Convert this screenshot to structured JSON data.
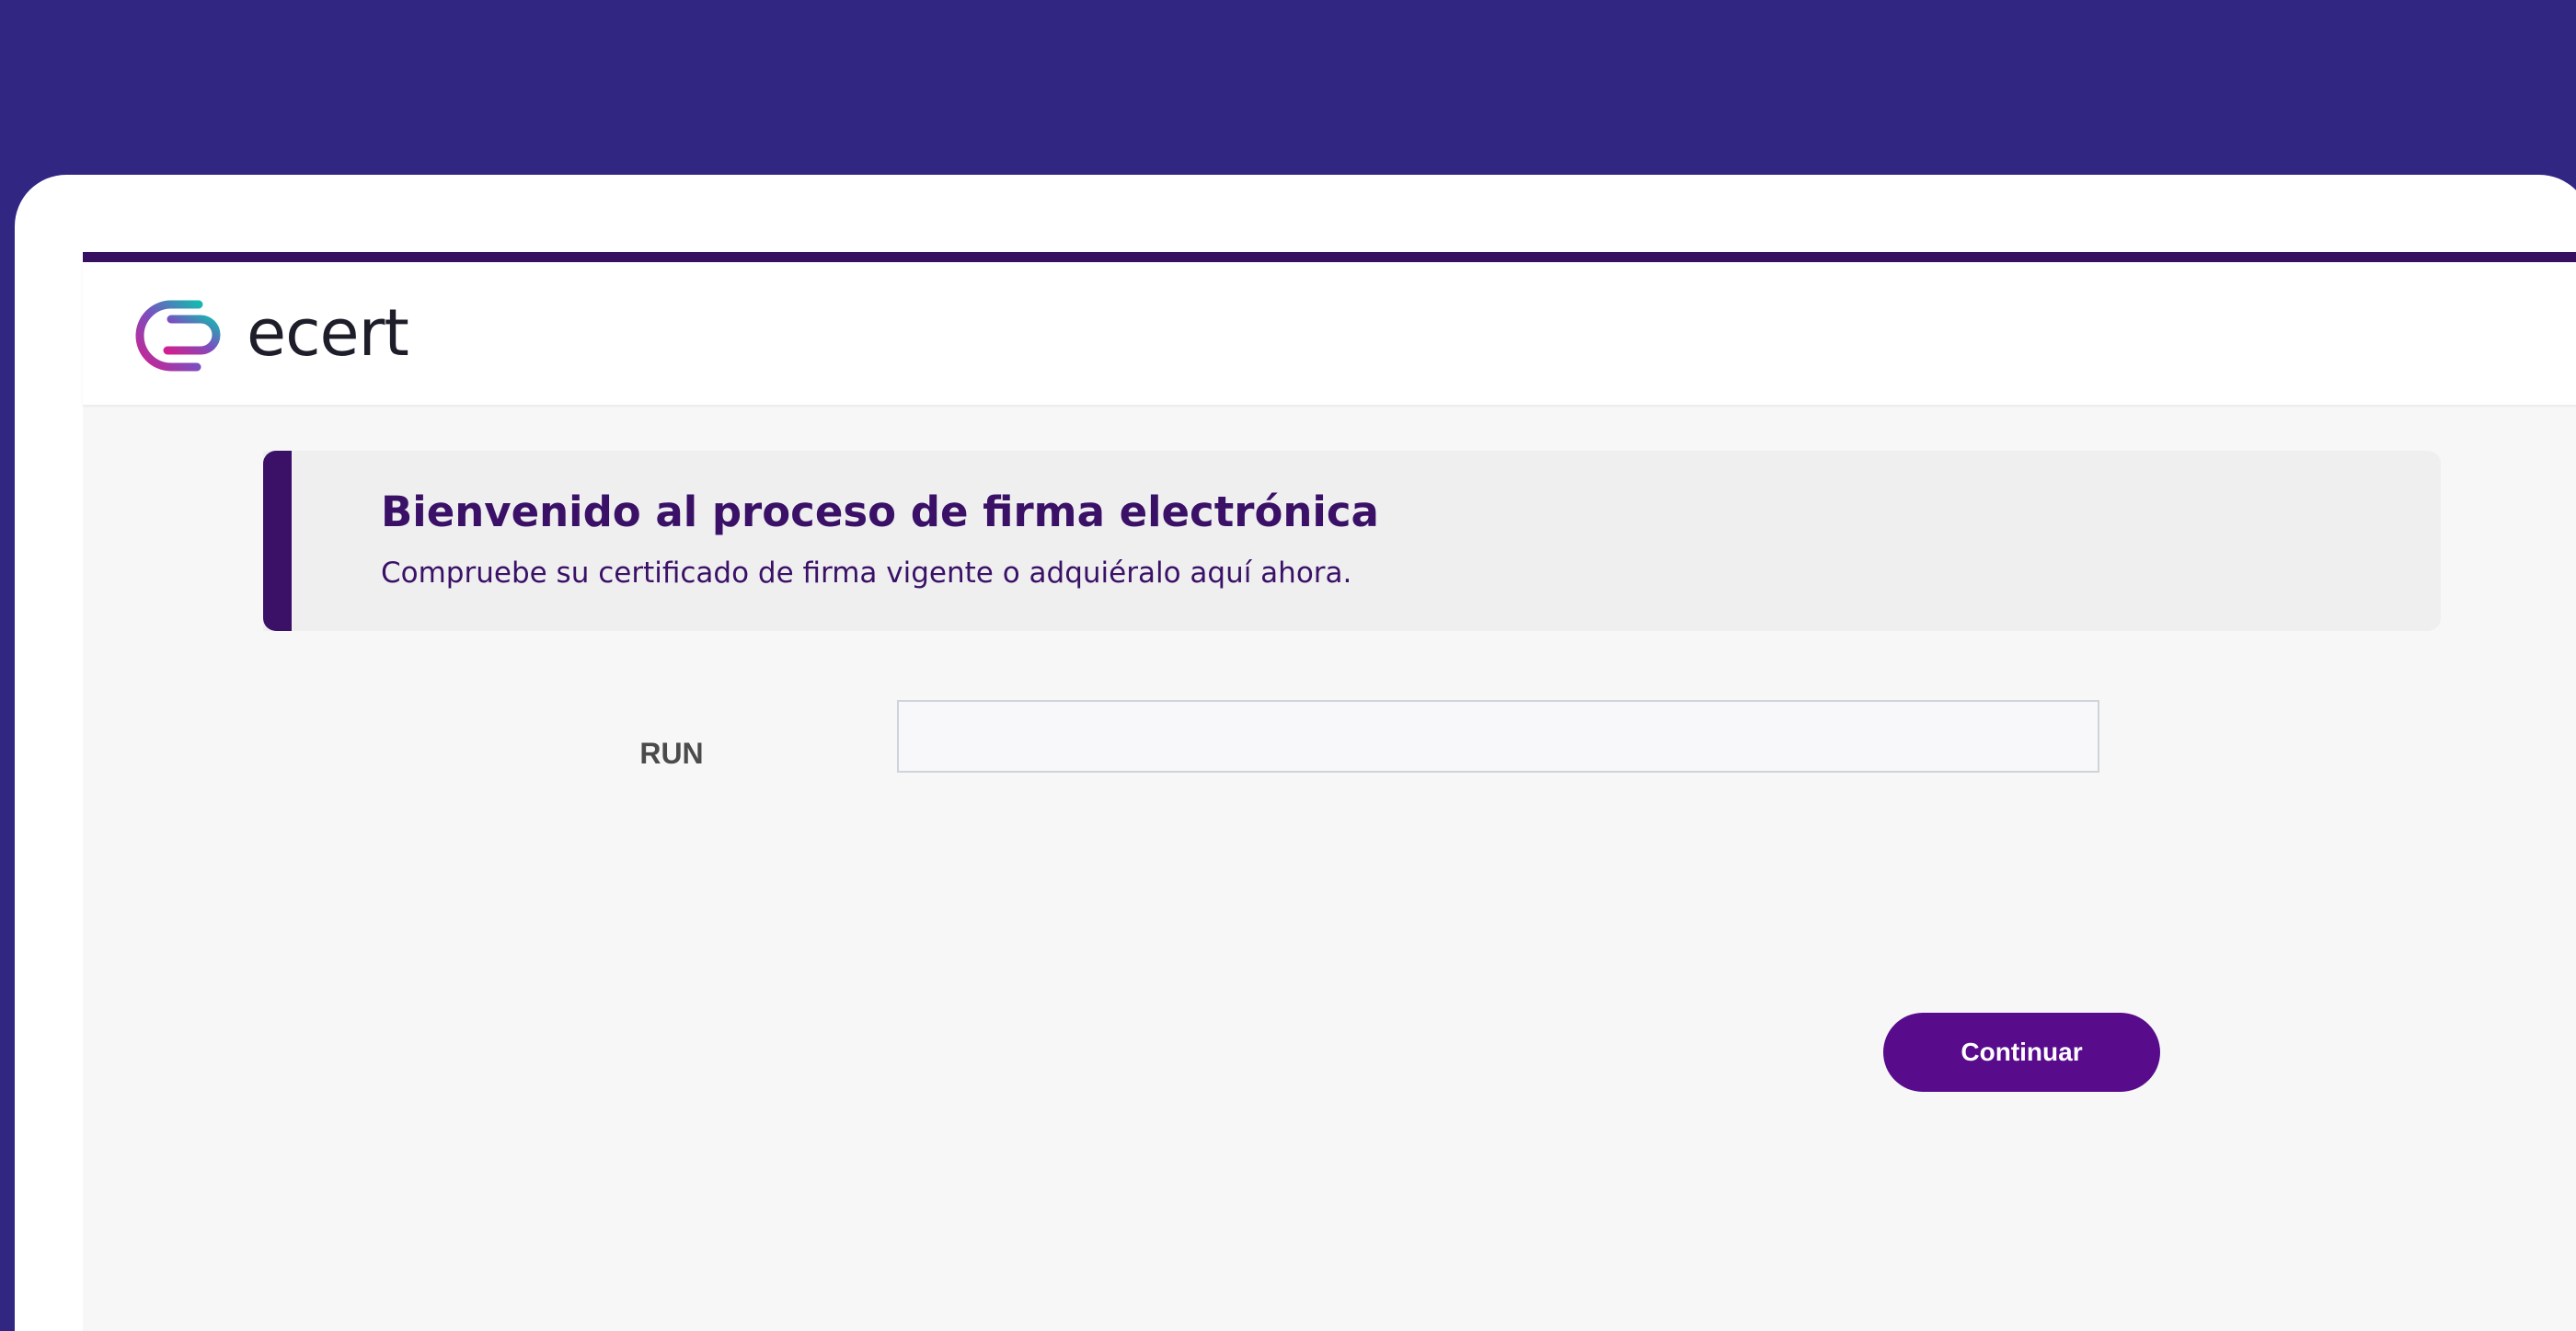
{
  "brand": {
    "name": "ecert",
    "logo_icon": "ecert-logo-icon",
    "colors": {
      "magenta": "#d0218f",
      "teal": "#17b7b0",
      "dark": "#1e1e2a"
    }
  },
  "welcome": {
    "title": "Bienvenido al proceso de firma electrónica",
    "subtitle": "Compruebe su certificado de firma vigente o adquiéralo aquí ahora."
  },
  "form": {
    "run_label": "RUN",
    "run_value": "",
    "run_placeholder": ""
  },
  "actions": {
    "continue_label": "Continuar"
  },
  "theme": {
    "background": "#312682",
    "accent": "#3a1167",
    "button": "#580c8c"
  }
}
